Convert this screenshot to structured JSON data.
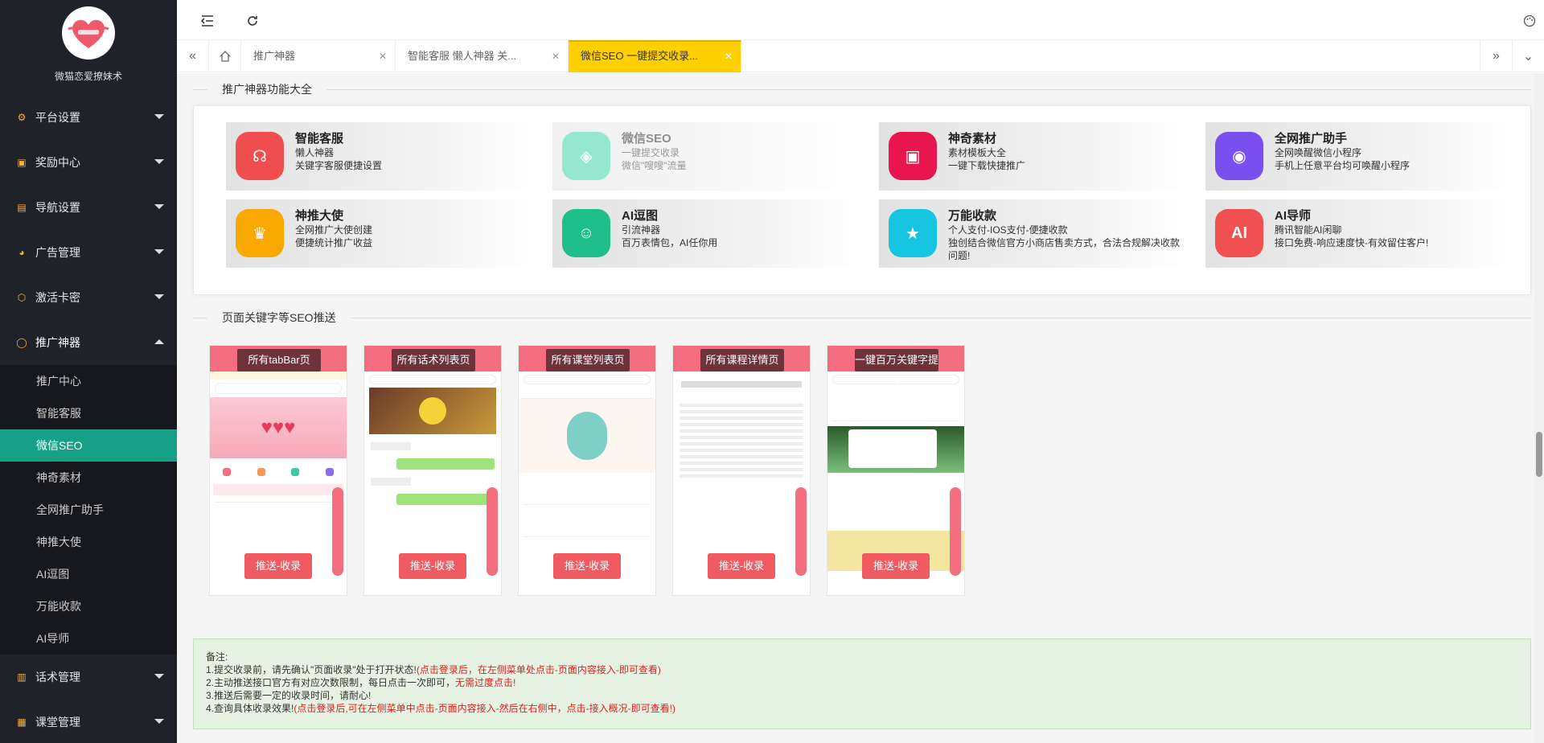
{
  "sidebar": {
    "brand": "微猫恋爱撩妹术",
    "menu": [
      {
        "label": "平台设置",
        "icon": "gear-icon"
      },
      {
        "label": "奖励中心",
        "icon": "reward-icon"
      },
      {
        "label": "导航设置",
        "icon": "nav-icon"
      },
      {
        "label": "广告管理",
        "icon": "palette-icon"
      },
      {
        "label": "激活卡密",
        "icon": "box-icon"
      },
      {
        "label": "推广神器",
        "icon": "circle-icon"
      }
    ],
    "submenu": [
      "推广中心",
      "智能客服",
      "微信SEO",
      "神奇素材",
      "全网推广助手",
      "神推大使",
      "AI逗图",
      "万能收款",
      "AI导师"
    ],
    "menu_bottom": [
      {
        "label": "话术管理",
        "icon": "chat-icon"
      },
      {
        "label": "课堂管理",
        "icon": "class-icon"
      }
    ]
  },
  "tabs": {
    "items": [
      {
        "label": "推广神器"
      },
      {
        "label": "智能客服 懒人神器 关..."
      },
      {
        "label": "微信SEO 一键提交收录..."
      }
    ]
  },
  "features": {
    "title": "推广神器功能大全",
    "items": [
      {
        "title": "智能客服",
        "lines": [
          "懒人神器",
          "关键字客服便捷设置"
        ],
        "color": "#f04e4e",
        "icon": "headset-icon"
      },
      {
        "title": "微信SEO",
        "lines": [
          "一键提交收录",
          "微信\"嗖嗖\"流量"
        ],
        "color": "#2ed3a0",
        "icon": "tag-icon"
      },
      {
        "title": "神奇素材",
        "lines": [
          "素材模板大全",
          "一键下载快捷推广"
        ],
        "color": "#e8154f",
        "icon": "material-icon"
      },
      {
        "title": "全网推广助手",
        "lines": [
          "全网唤醒微信小程序",
          "手机上任意平台均可唤醒小程序"
        ],
        "color": "#7a4ff0",
        "icon": "bulb-icon"
      },
      {
        "title": "神推大使",
        "lines": [
          "全网推广大使创建",
          "便捷统计推广收益"
        ],
        "color": "#f8a800",
        "icon": "trophy-icon"
      },
      {
        "title": "AI逗图",
        "lines": [
          "引流神器",
          "百万表情包，AI任你用"
        ],
        "color": "#1ebf8a",
        "icon": "smiley-icon"
      },
      {
        "title": "万能收款",
        "lines": [
          "个人支付-IOS支付-便捷收款",
          "独创结合微信官方小商店售卖方式，合法合规解决收款问题!"
        ],
        "color": "#16c6e0",
        "icon": "shield-icon"
      },
      {
        "title": "AI导师",
        "lines": [
          "腾讯智能AI闲聊",
          "接口免费-响应速度快-有效留住客户!"
        ],
        "color": "#f05050",
        "icon": "ai-icon"
      }
    ]
  },
  "seo": {
    "title": "页面关键字等SEO推送",
    "pages": [
      {
        "label": "所有tabBar页",
        "button": "推送-收录"
      },
      {
        "label": "所有话术列表页",
        "button": "推送-收录"
      },
      {
        "label": "所有课堂列表页",
        "button": "推送-收录"
      },
      {
        "label": "所有课程详情页",
        "button": "推送-收录"
      },
      {
        "label": "一键百万关键字提交",
        "button": "推送-收录"
      }
    ]
  },
  "notes": {
    "heading": "备注:",
    "lines": [
      {
        "text": "1.提交收录前，请先确认\"页面收录\"处于打开状态!",
        "red": "(点击登录后，在左侧菜单处点击-页面内容接入-即可查看)"
      },
      {
        "text": "2.主动推送接口官方有对应次数限制，每日点击一次即可，",
        "red": "无需过度点击!"
      },
      {
        "text": "3.推送后需要一定的收录时间，请耐心!",
        "red": ""
      },
      {
        "text": "4.查询具体收录效果!",
        "red": "(点击登录后,可在左侧菜单中点击-页面内容接入-然后在右侧中，点击-接入概况-即可查看!)"
      }
    ]
  },
  "colors": {
    "accent": "#16a085",
    "tab_active": "#ffd000",
    "push_button": "#f05a61"
  }
}
